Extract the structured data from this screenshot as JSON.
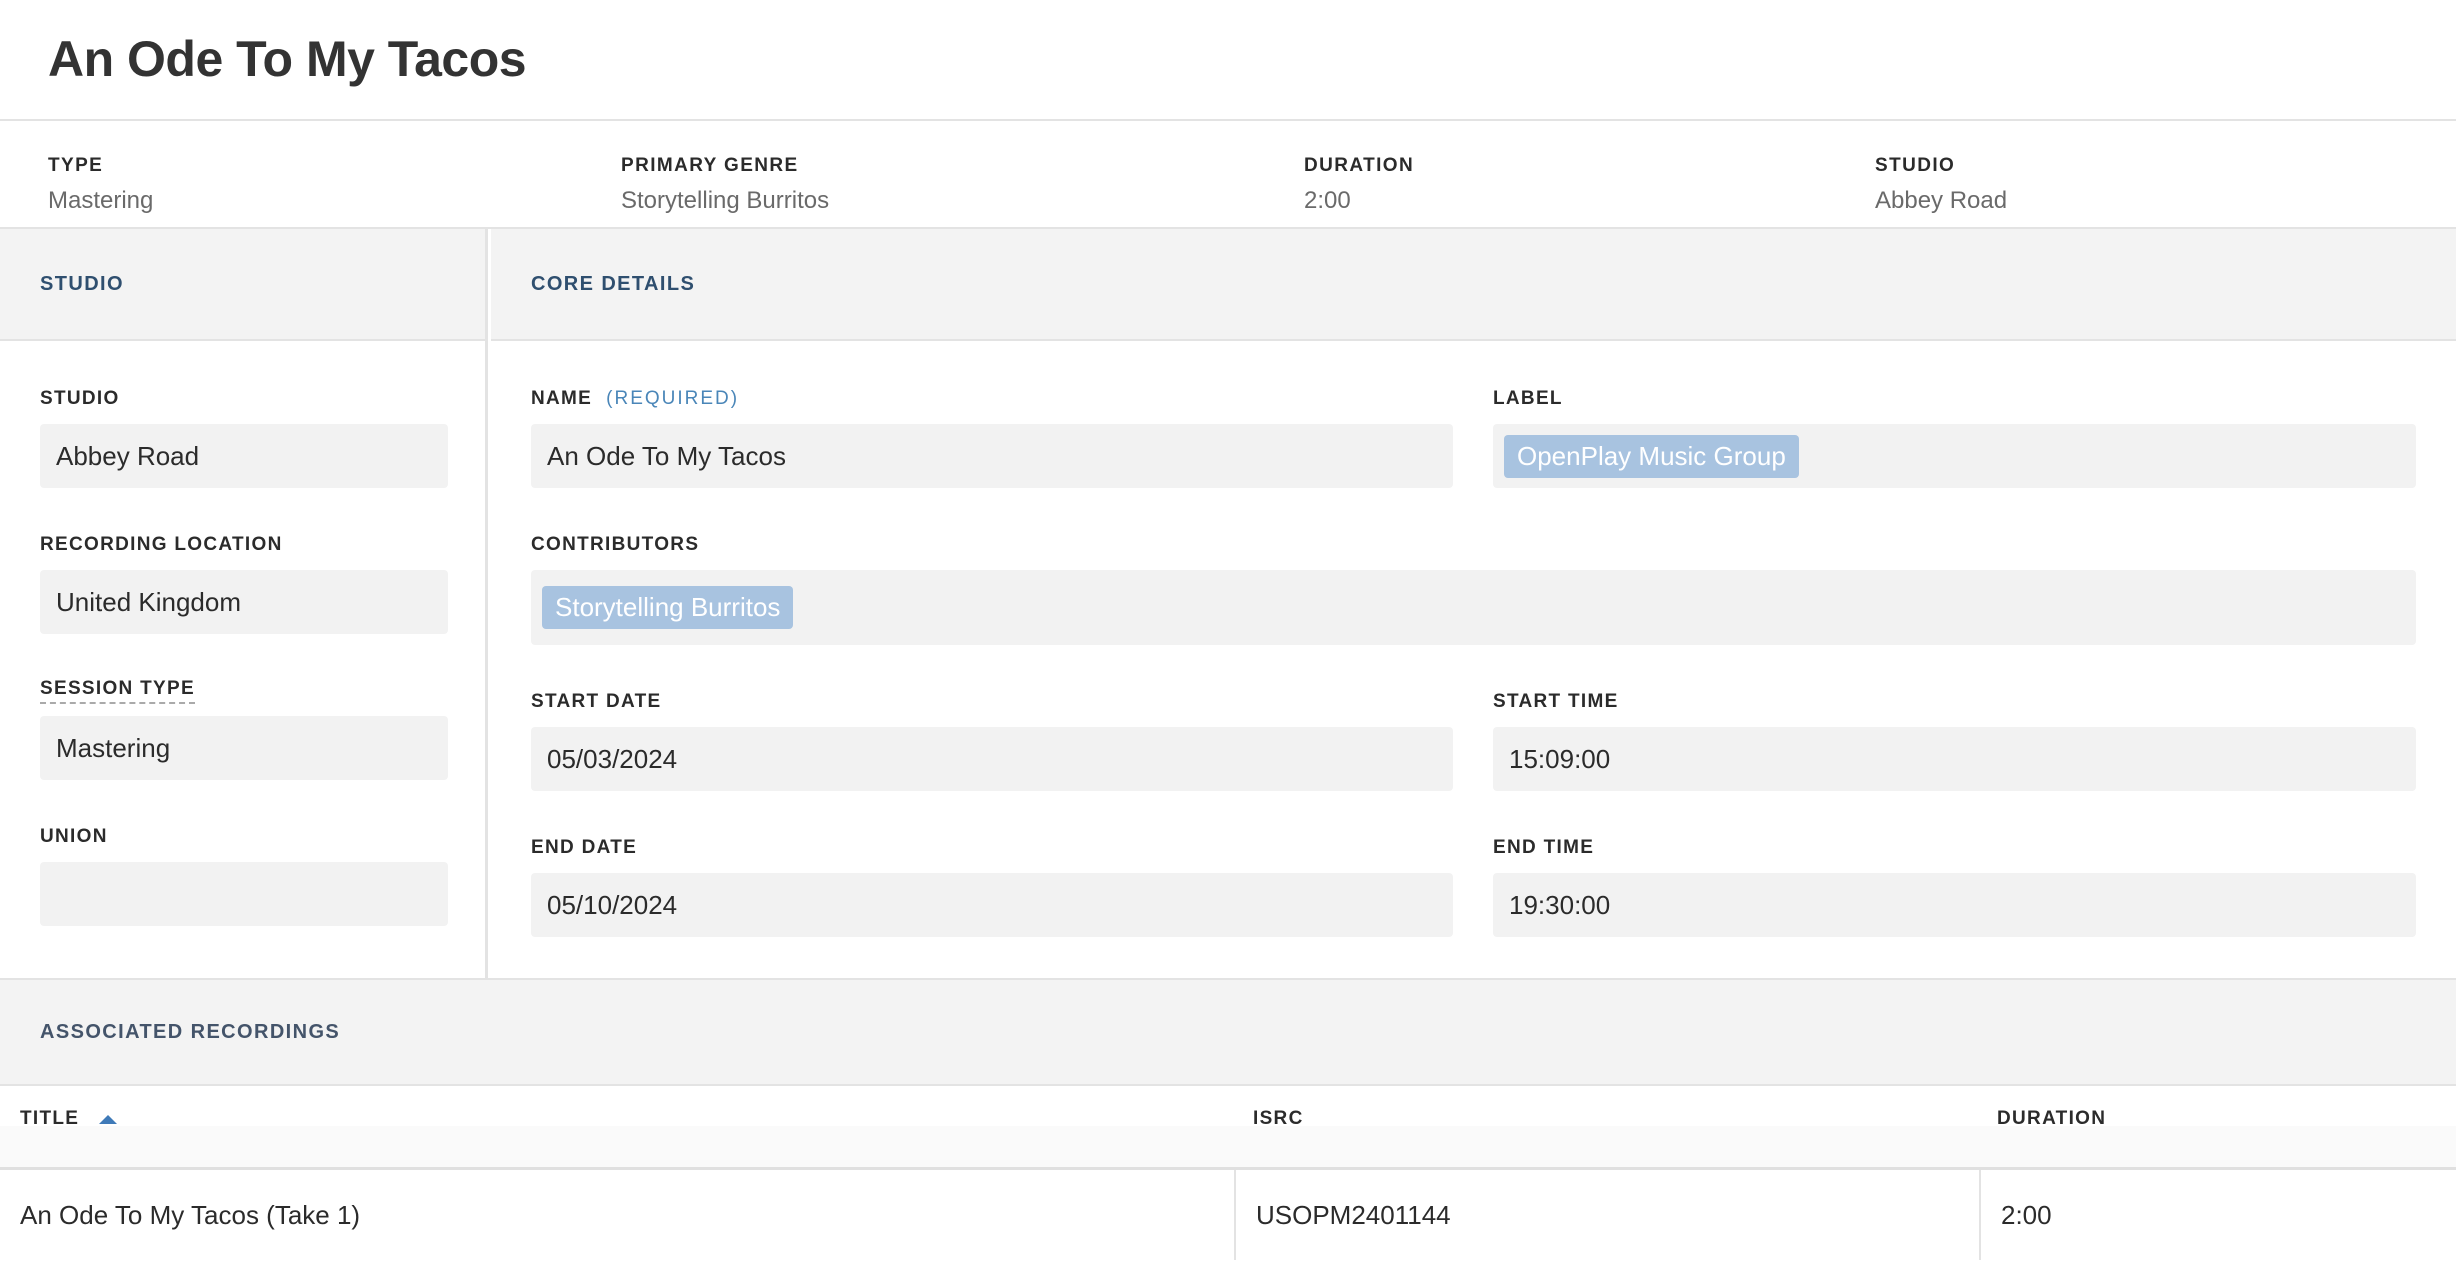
{
  "page": {
    "title": "An Ode To My Tacos"
  },
  "summary": [
    {
      "label": "TYPE",
      "value": "Mastering"
    },
    {
      "label": "PRIMARY GENRE",
      "value": "Storytelling Burritos"
    },
    {
      "label": "DURATION",
      "value": "2:00"
    },
    {
      "label": "STUDIO",
      "value": "Abbey Road"
    }
  ],
  "studio_section": {
    "heading": "STUDIO",
    "fields": {
      "studio": {
        "label": "STUDIO",
        "value": "Abbey Road"
      },
      "recording_location": {
        "label": "RECORDING LOCATION",
        "value": "United Kingdom"
      },
      "session_type": {
        "label": "SESSION TYPE",
        "value": "Mastering"
      },
      "union": {
        "label": "UNION",
        "value": ""
      }
    }
  },
  "core_section": {
    "heading": "CORE DETAILS",
    "fields": {
      "name": {
        "label": "NAME",
        "required_label": "(REQUIRED)",
        "value": "An Ode To My Tacos"
      },
      "label": {
        "label": "LABEL",
        "tag": "OpenPlay Music Group"
      },
      "contributors": {
        "label": "CONTRIBUTORS",
        "tag": "Storytelling Burritos"
      },
      "start_date": {
        "label": "START DATE",
        "value": "05/03/2024"
      },
      "start_time": {
        "label": "START TIME",
        "value": "15:09:00"
      },
      "end_date": {
        "label": "END DATE",
        "value": "05/10/2024"
      },
      "end_time": {
        "label": "END TIME",
        "value": "19:30:00"
      }
    }
  },
  "recordings": {
    "heading": "ASSOCIATED RECORDINGS",
    "columns": [
      "TITLE",
      "ISRC",
      "DURATION"
    ],
    "sort_icon": "sort-ascending-icon",
    "rows": [
      {
        "title": "An Ode To My Tacos (Take 1)",
        "isrc": "USOPM2401144",
        "duration": "2:00"
      }
    ]
  },
  "colors": {
    "section_heading": "#2f4f6f",
    "tag_background": "#a8c3e0",
    "required_text": "#4a86b8",
    "field_background": "#f2f2f2"
  }
}
